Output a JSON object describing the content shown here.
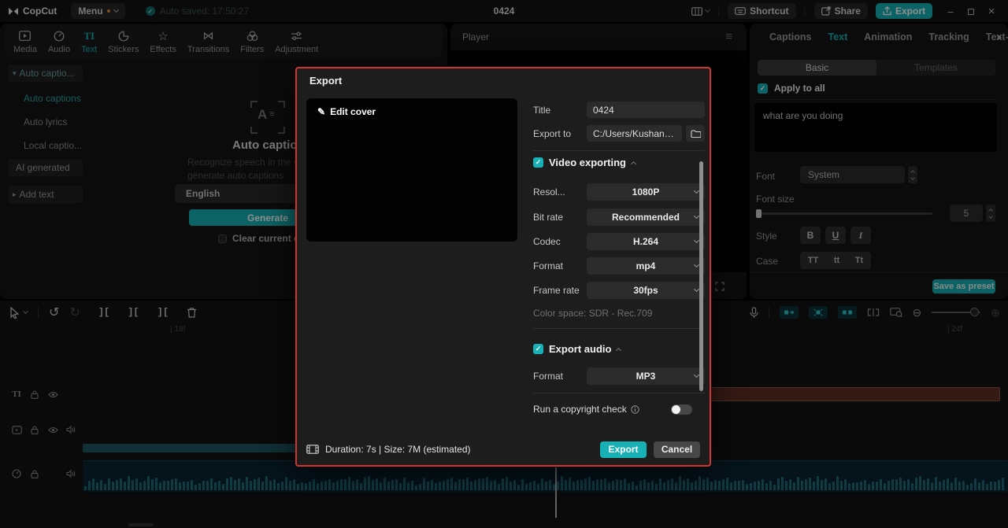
{
  "topbar": {
    "logo_text": "CopCut",
    "menu_label": "Menu",
    "autosave_text": "Auto saved: 17:50:27",
    "project_title": "0424",
    "shortcut_label": "Shortcut",
    "share_label": "Share",
    "export_label": "Export"
  },
  "media_toolbar": {
    "tabs": [
      {
        "label": "Media"
      },
      {
        "label": "Audio"
      },
      {
        "label": "Text"
      },
      {
        "label": "Stickers"
      },
      {
        "label": "Effects"
      },
      {
        "label": "Transitions"
      },
      {
        "label": "Filters"
      },
      {
        "label": "Adjustment"
      }
    ]
  },
  "sidebar": {
    "items": [
      {
        "label": "Auto captio..."
      },
      {
        "label": "Auto captions"
      },
      {
        "label": "Auto lyrics"
      },
      {
        "label": "Local captio..."
      },
      {
        "label": "AI generated"
      },
      {
        "label": "Add text"
      }
    ]
  },
  "captions_panel": {
    "title": "Auto captions",
    "description_line1": "Recognize speech in the vid",
    "description_line2": "generate auto captions",
    "language_value": "English",
    "generate_label": "Generate",
    "clear_label": "Clear current cap"
  },
  "player": {
    "title": "Player"
  },
  "right_panel": {
    "tabs": [
      {
        "label": "Captions"
      },
      {
        "label": "Text"
      },
      {
        "label": "Animation"
      },
      {
        "label": "Tracking"
      },
      {
        "label": "Text-to-s"
      }
    ],
    "more_glyph": "»",
    "basic_tab": "Basic",
    "templates_tab": "Templates",
    "apply_to_all": "Apply to all",
    "caption_text": "what are you doing",
    "font_label": "Font",
    "font_value": "System",
    "font_size_label": "Font size",
    "font_size_value": "5",
    "style_label": "Style",
    "style_bold": "B",
    "style_underline": "U",
    "style_italic": "I",
    "case_label": "Case",
    "case_upper": "TT",
    "case_lower": "tt",
    "case_title": "Tt",
    "save_preset_label": "Save as preset"
  },
  "timeline": {
    "ruler_mark_left": "| 18f",
    "ruler_mark_right": "| 24f",
    "text_track_icon": "TI"
  },
  "export_dialog": {
    "title": "Export",
    "edit_cover_label": "Edit cover",
    "title_field": {
      "label": "Title",
      "value": "0424"
    },
    "export_to": {
      "label": "Export to",
      "value": "C:/Users/Kushani Nim..."
    },
    "video_section": {
      "label": "Video exporting",
      "fields": [
        {
          "label": "Resol...",
          "value": "1080P"
        },
        {
          "label": "Bit rate",
          "value": "Recommended"
        },
        {
          "label": "Codec",
          "value": "H.264"
        },
        {
          "label": "Format",
          "value": "mp4"
        },
        {
          "label": "Frame rate",
          "value": "30fps"
        }
      ],
      "color_space": "Color space: SDR - Rec.709"
    },
    "audio_section": {
      "label": "Export audio",
      "format_label": "Format",
      "format_value": "MP3"
    },
    "copyright_label": "Run a copyright check",
    "summary": "Duration: 7s | Size: 7M (estimated)",
    "export_button": "Export",
    "cancel_button": "Cancel"
  },
  "icons": {
    "caret_down": "▾",
    "caret_right": "▸",
    "check": "✓",
    "undo": "↺",
    "redo": "↻",
    "split": "][",
    "zoom_out": "⊖",
    "zoom_in": "⊕",
    "edit_pencil": "✎",
    "star": "☆",
    "bowtie": "⋈",
    "hamburger": "≡",
    "minimize": "–",
    "close": "×",
    "ti": "TI"
  },
  "colors": {
    "accent": "#17b1b5",
    "dialog_border": "#ce3730",
    "text_clip": "#5d2e25",
    "waveform": "#1f6878"
  }
}
